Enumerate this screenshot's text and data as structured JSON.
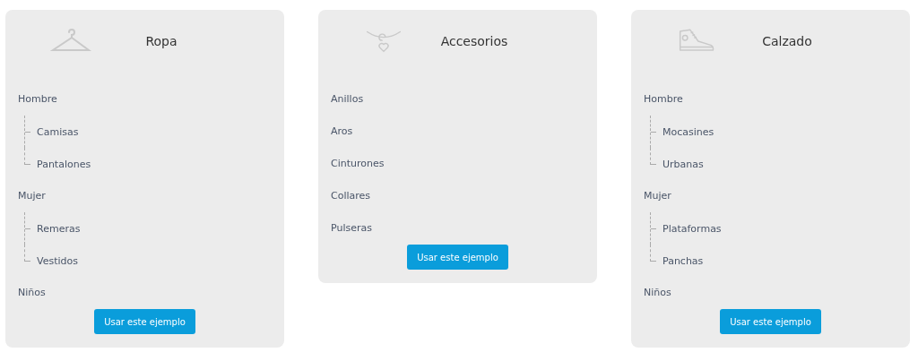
{
  "cards": [
    {
      "kind": "clothing",
      "title": "Ropa",
      "items": [
        {
          "label": "Hombre",
          "children": [
            {
              "label": "Camisas"
            },
            {
              "label": "Pantalones"
            }
          ]
        },
        {
          "label": "Mujer",
          "children": [
            {
              "label": "Remeras"
            },
            {
              "label": "Vestidos"
            }
          ]
        },
        {
          "label": "Niños"
        }
      ],
      "button": "Usar este ejemplo"
    },
    {
      "kind": "accessories",
      "title": "Accesorios",
      "items": [
        {
          "label": "Anillos"
        },
        {
          "label": "Aros"
        },
        {
          "label": "Cinturones"
        },
        {
          "label": "Collares"
        },
        {
          "label": "Pulseras"
        }
      ],
      "button": "Usar este ejemplo"
    },
    {
      "kind": "footwear",
      "title": "Calzado",
      "items": [
        {
          "label": "Hombre",
          "children": [
            {
              "label": "Mocasines"
            },
            {
              "label": "Urbanas"
            }
          ]
        },
        {
          "label": "Mujer",
          "children": [
            {
              "label": "Plataformas"
            },
            {
              "label": "Panchas"
            }
          ]
        },
        {
          "label": "Niños"
        }
      ],
      "button": "Usar este ejemplo"
    }
  ]
}
